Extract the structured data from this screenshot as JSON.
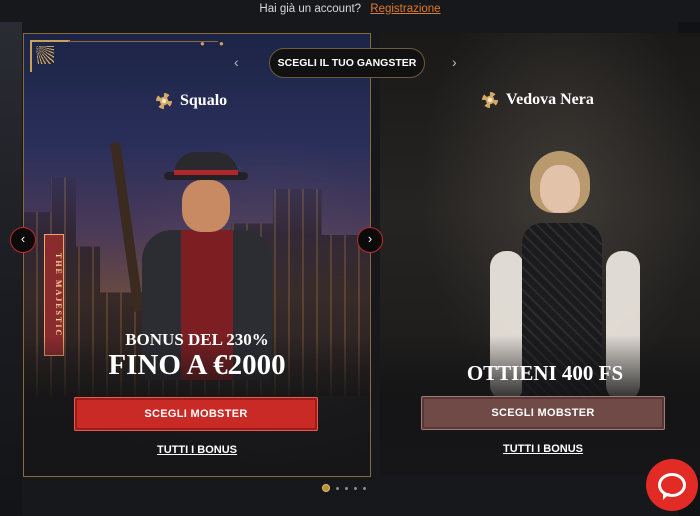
{
  "topbar": {
    "prompt": "Hai già un account?",
    "register_link": "Registrazione"
  },
  "selector": {
    "label": "SCEGLI IL TUO GANGSTER",
    "prev": "‹",
    "next": "›"
  },
  "cards": [
    {
      "name": "Squalo",
      "offer_line1": "BONUS DEL 230%",
      "offer_line2": "FINO A €2000",
      "cta": "SCEGLI MOBSTER",
      "bonus_link": "TUTTI I BONUS",
      "sign": "THE MAJESTIC"
    },
    {
      "name": "Vedova Nera",
      "offer": "OTTIENI 400 FS",
      "cta": "SCEGLI MOBSTER",
      "bonus_link": "TUTTI I BONUS"
    }
  ],
  "carousel": {
    "prev_arrow": "‹",
    "next_arrow": "›",
    "pages": 5,
    "active_page": 1
  },
  "colors": {
    "accent_red": "#c92a25",
    "muted_cta": "#6f4a47",
    "gold": "#c9a25a",
    "link_orange": "#e0792c"
  },
  "icons": [
    "flower-icon",
    "chevron-left-icon",
    "chevron-right-icon",
    "chat-icon"
  ]
}
